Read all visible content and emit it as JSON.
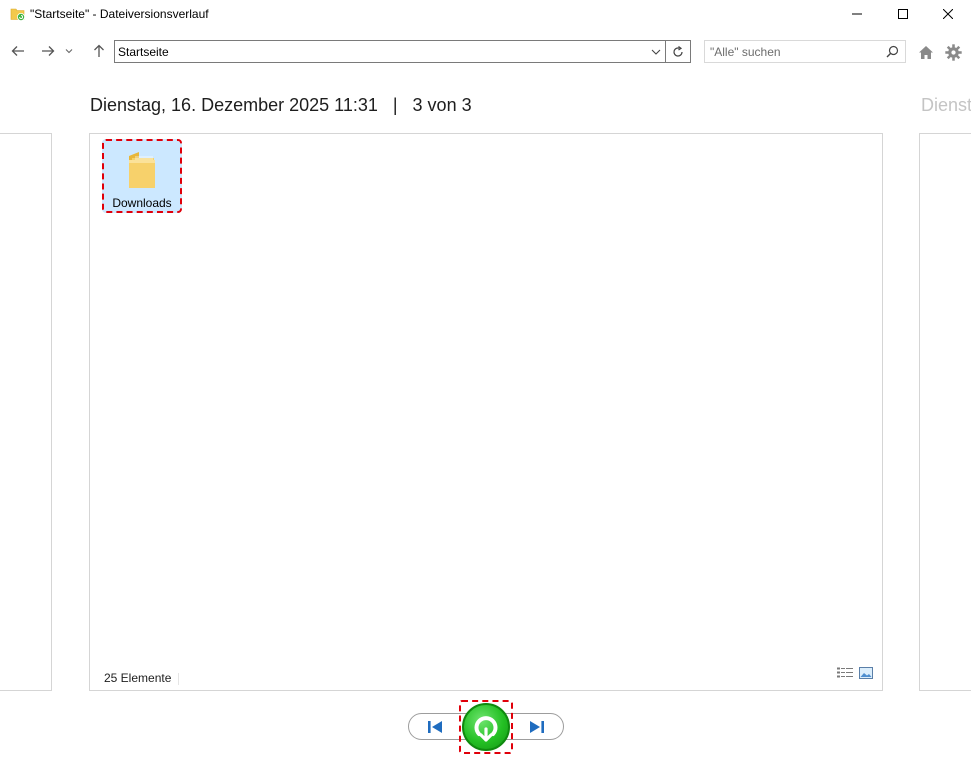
{
  "window": {
    "title": "\"Startseite\" - Dateiversionsverlauf"
  },
  "navigation": {
    "address": "Startseite",
    "search_placeholder": "\"Alle\" suchen"
  },
  "header": {
    "date": "Dienstag, 16. Dezember 2025 11:31",
    "separator": "|",
    "position": "3 von 3",
    "next_date_partial": "Dienstag"
  },
  "main": {
    "items": [
      {
        "label": "Downloads",
        "icon": "folder-icon"
      }
    ],
    "status": {
      "count": "25 Elemente"
    }
  },
  "colors": {
    "accent_highlight": "#cce8ff",
    "annotation_red": "#e0000a",
    "restore_green": "#24c024",
    "nav_blue": "#1f6cbf"
  }
}
